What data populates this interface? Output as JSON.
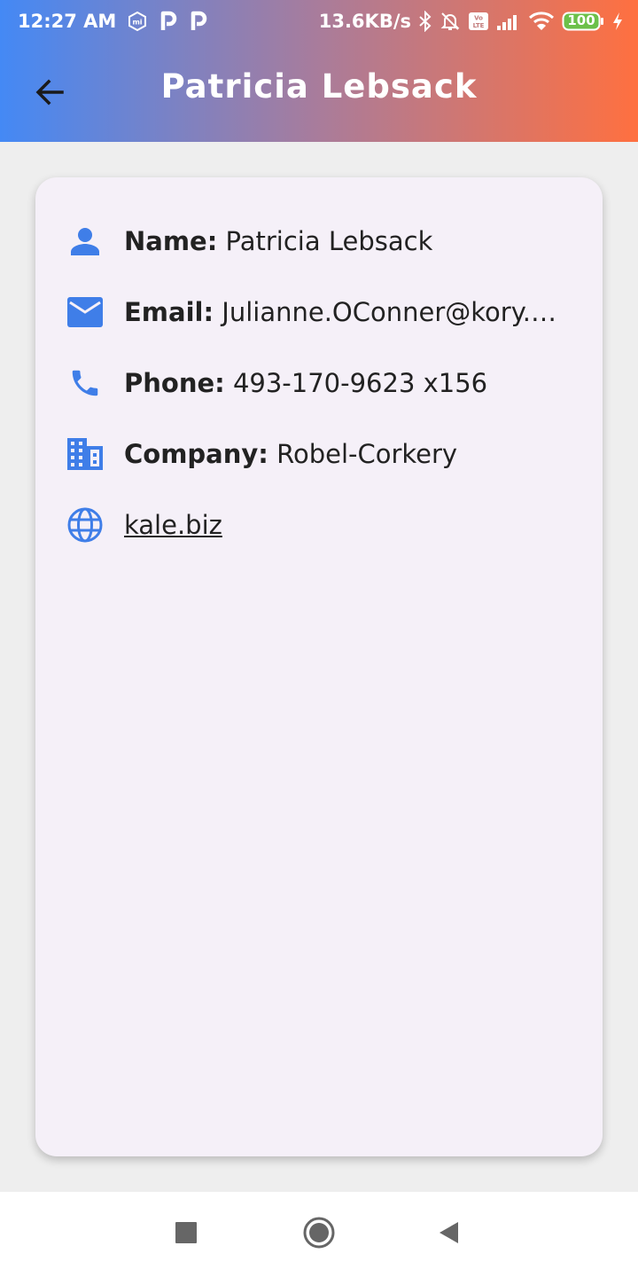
{
  "status_bar": {
    "time": "12:27 AM",
    "net_speed": "13.6KB/s",
    "battery": "100",
    "icons": [
      "mi-icon",
      "p-icon",
      "p-icon",
      "bluetooth-icon",
      "bell-off-icon",
      "volte-icon",
      "signal-icon",
      "wifi-icon",
      "battery-icon",
      "charging-icon"
    ]
  },
  "app_bar": {
    "title": "Patricia Lebsack",
    "back_icon": "arrow-back-icon"
  },
  "details": {
    "name_label": "Name:",
    "name_value": "Patricia Lebsack",
    "email_label": "Email:",
    "email_value": "Julianne.OConner@kory.org",
    "phone_label": "Phone:",
    "phone_value": "493-170-9623 x156",
    "company_label": "Company:",
    "company_value": "Robel-Corkery",
    "website": "kale.biz"
  },
  "colors": {
    "accent": "#3f7ee8",
    "gradient_start": "#4489f5",
    "gradient_end": "#ff7040",
    "card": "#f5f0f8",
    "background": "#eeeeee"
  },
  "nav_bar": {
    "icons": [
      "recents-square-icon",
      "home-circle-icon",
      "back-triangle-icon"
    ]
  }
}
